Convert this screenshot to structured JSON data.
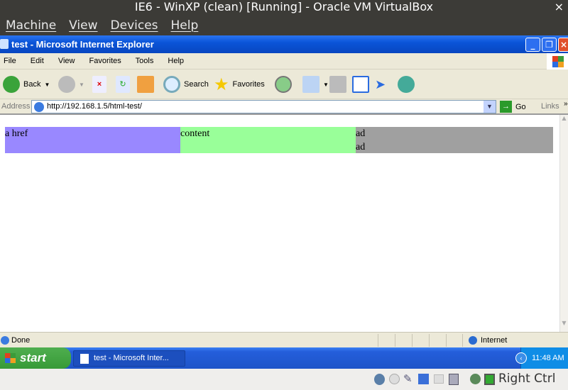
{
  "vbox": {
    "title": "IE6 - WinXP (clean) [Running] - Oracle VM VirtualBox",
    "close": "×",
    "menu": [
      "Machine",
      "View",
      "Devices",
      "Help"
    ],
    "host_key": "Right Ctrl"
  },
  "ie": {
    "title": "test - Microsoft Internet Explorer",
    "menu": [
      "File",
      "Edit",
      "View",
      "Favorites",
      "Tools",
      "Help"
    ],
    "toolbar": {
      "back": "Back",
      "search": "Search",
      "favorites": "Favorites"
    },
    "address_label": "Address",
    "address": "http://192.168.1.5/html-test/",
    "go": "Go",
    "links": "Links",
    "status": "Done",
    "zone": "Internet"
  },
  "page": {
    "cells": [
      {
        "text": "a href",
        "color": "#9988ff"
      },
      {
        "text": "content",
        "color": "#99ff99"
      },
      {
        "text": "ad",
        "text2": "ad",
        "color": "#a0a0a0"
      }
    ]
  },
  "taskbar": {
    "start": "start",
    "task": "test - Microsoft Inter...",
    "clock": "11:48 AM"
  }
}
